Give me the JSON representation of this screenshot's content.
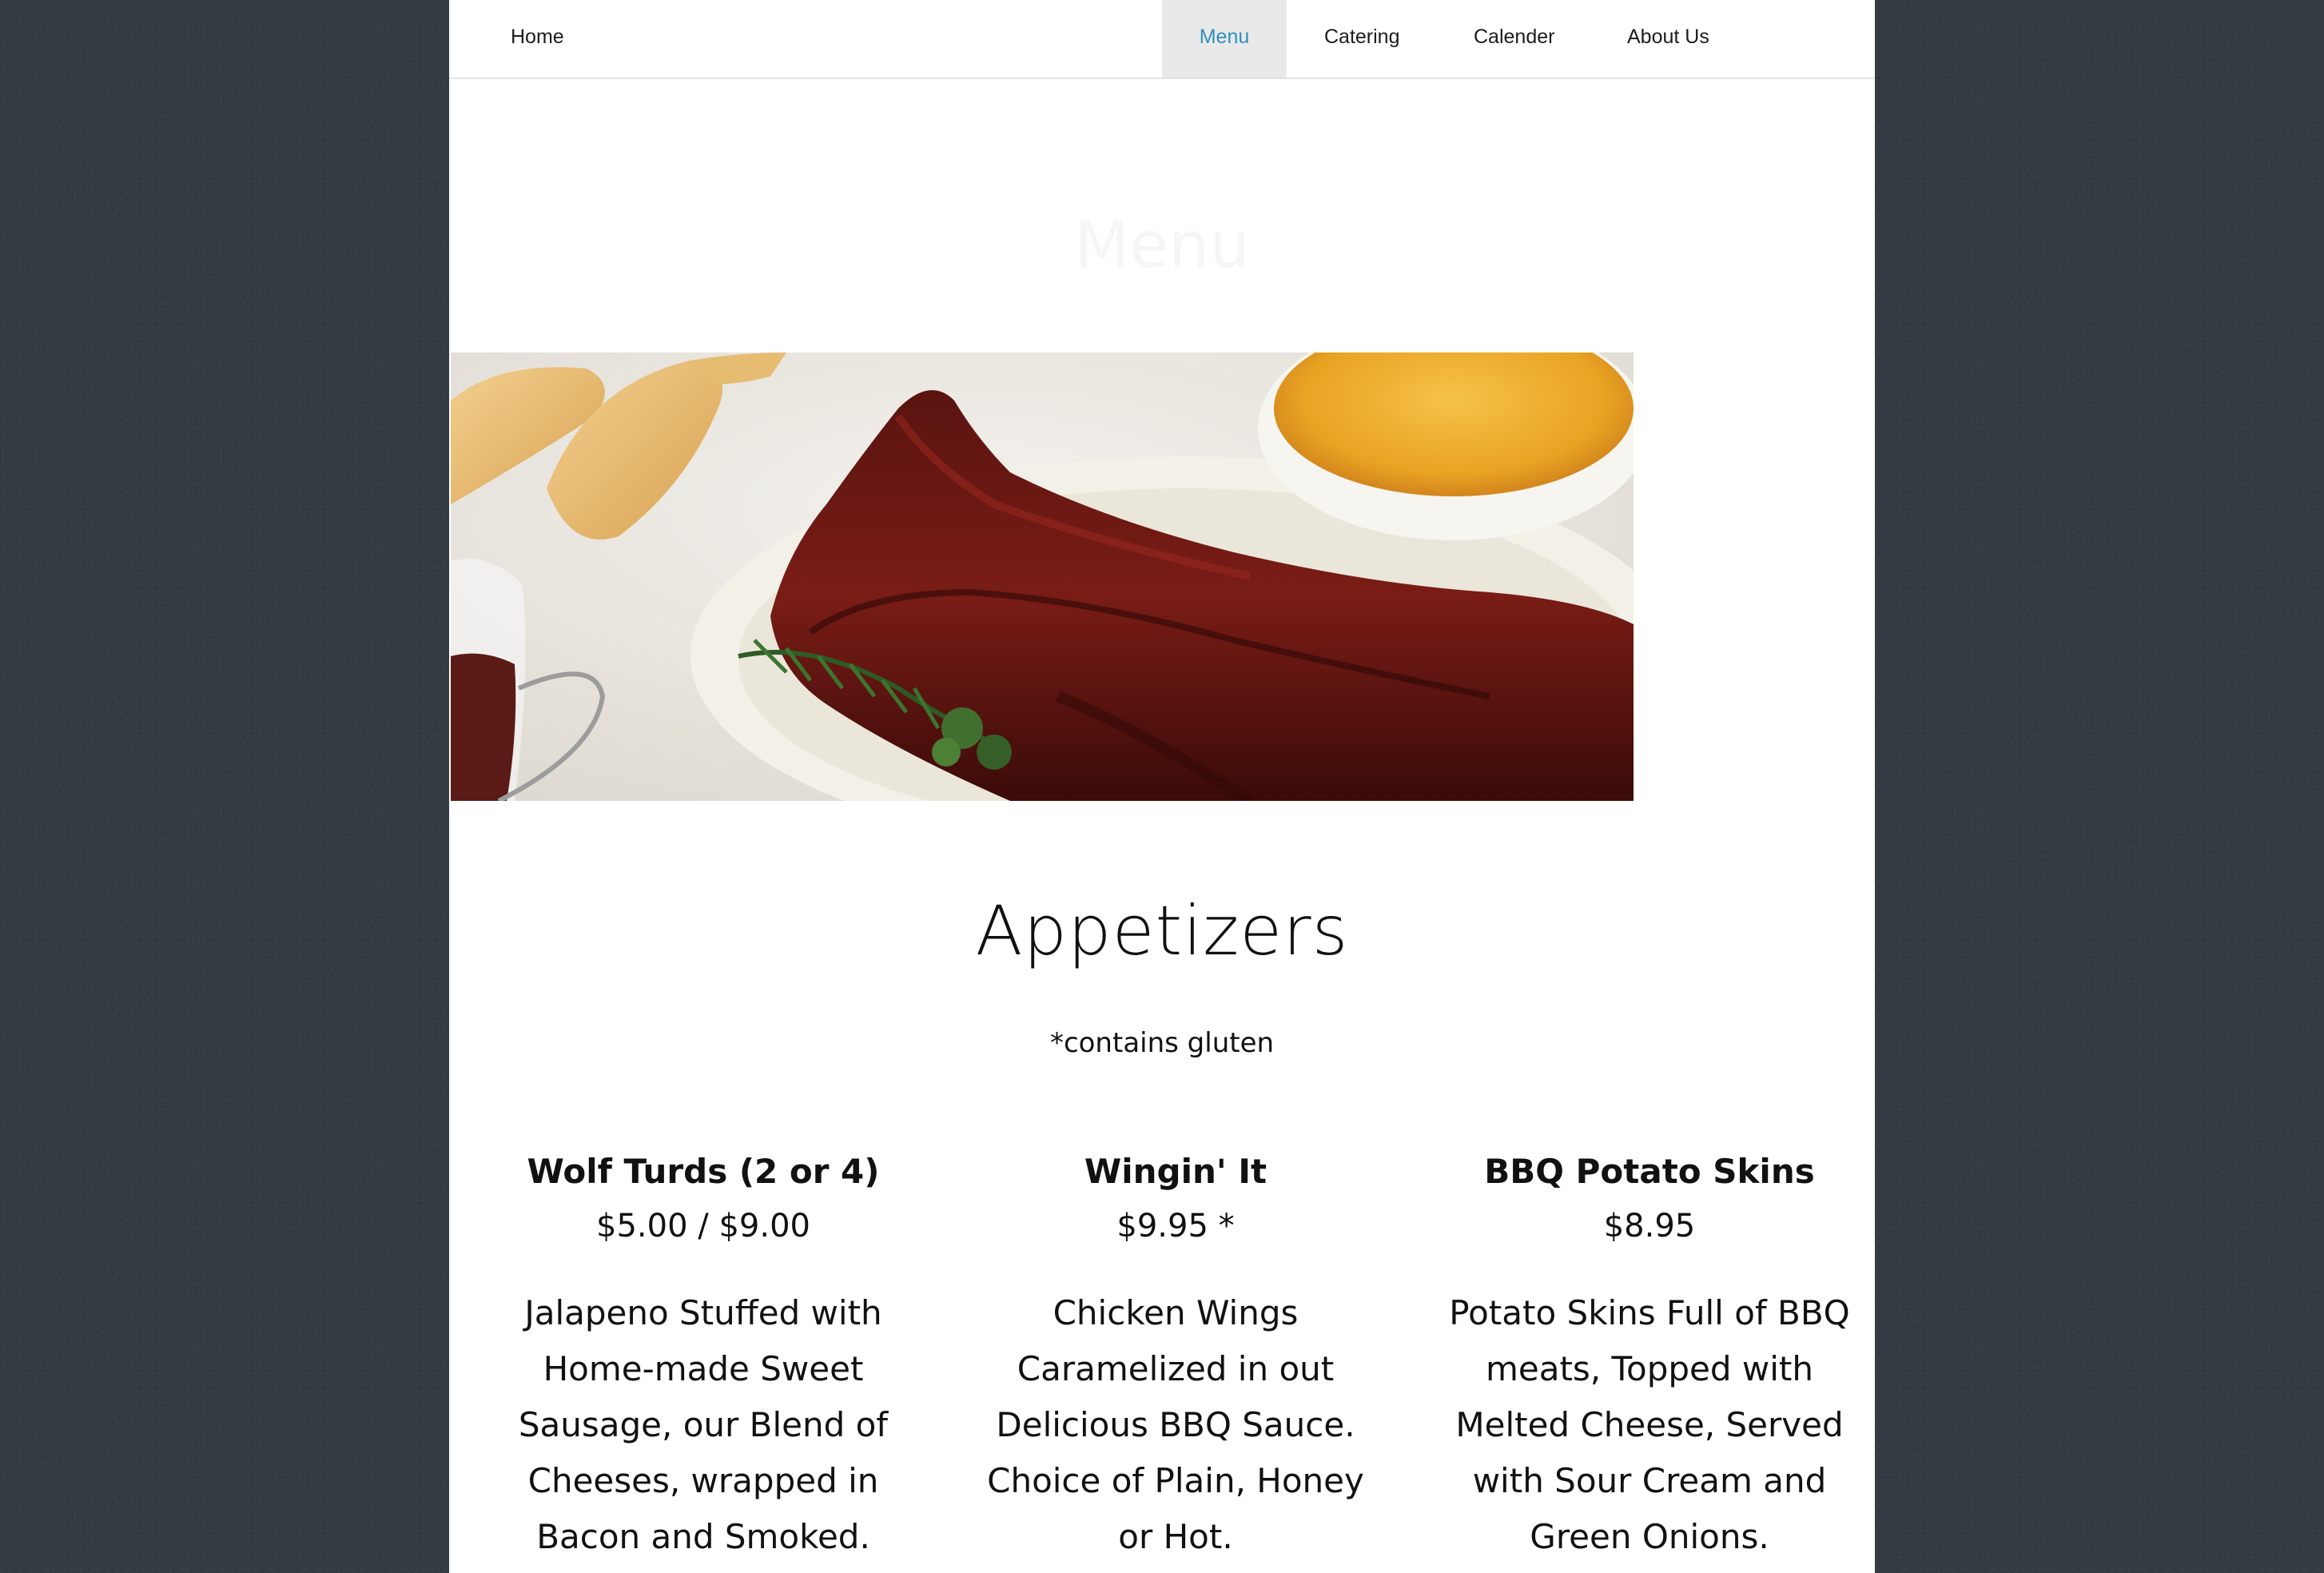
{
  "nav": {
    "home": "Home",
    "menu": "Menu",
    "catering": "Catering",
    "calender": "Calender",
    "about": "About Us"
  },
  "hero": {
    "title": "Menu"
  },
  "section": {
    "title": "Appetizers",
    "note": "*contains gluten"
  },
  "items": [
    {
      "name": "Wolf Turds (2 or 4)",
      "price": "$5.00 / $9.00",
      "description": "Jalapeno Stuffed with Home-made Sweet Sausage, our Blend of Cheeses, wrapped in Bacon and Smoked."
    },
    {
      "name": "Wingin' It",
      "price": "$9.95 *",
      "description": "Chicken Wings Caramelized in out Delicious BBQ Sauce. Choice of Plain, Honey or Hot."
    },
    {
      "name": "BBQ Potato Skins",
      "price": "$8.95",
      "description": "Potato Skins Full of BBQ meats, Topped with Melted Cheese, Served with Sour Cream and Green Onions."
    }
  ],
  "colors": {
    "active_nav": "#2e8fbf",
    "page_background": "#343b42"
  }
}
